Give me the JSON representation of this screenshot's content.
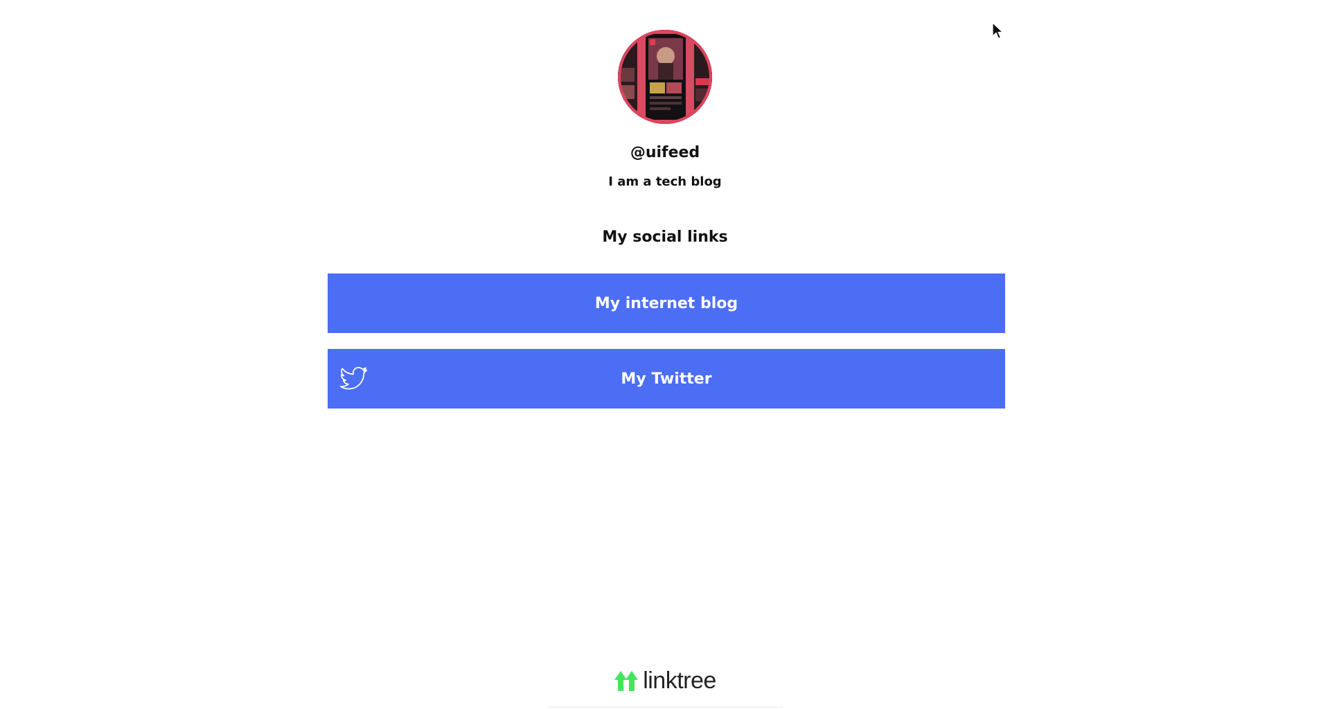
{
  "profile": {
    "username": "@uifeed",
    "bio": "I am a tech blog",
    "avatar_icon": "avatar-image"
  },
  "section": {
    "title": "My social links"
  },
  "links": [
    {
      "label": "My internet blog",
      "icon": null
    },
    {
      "label": "My Twitter",
      "icon": "twitter-bird-icon"
    }
  ],
  "footer": {
    "brand": "linktree",
    "brand_icon": "linktree-logo-icon"
  },
  "colors": {
    "button_bg": "#4c6ef5",
    "button_text": "#ffffff",
    "logo_green": "#43e55e",
    "avatar_ring": "#e0445c"
  }
}
